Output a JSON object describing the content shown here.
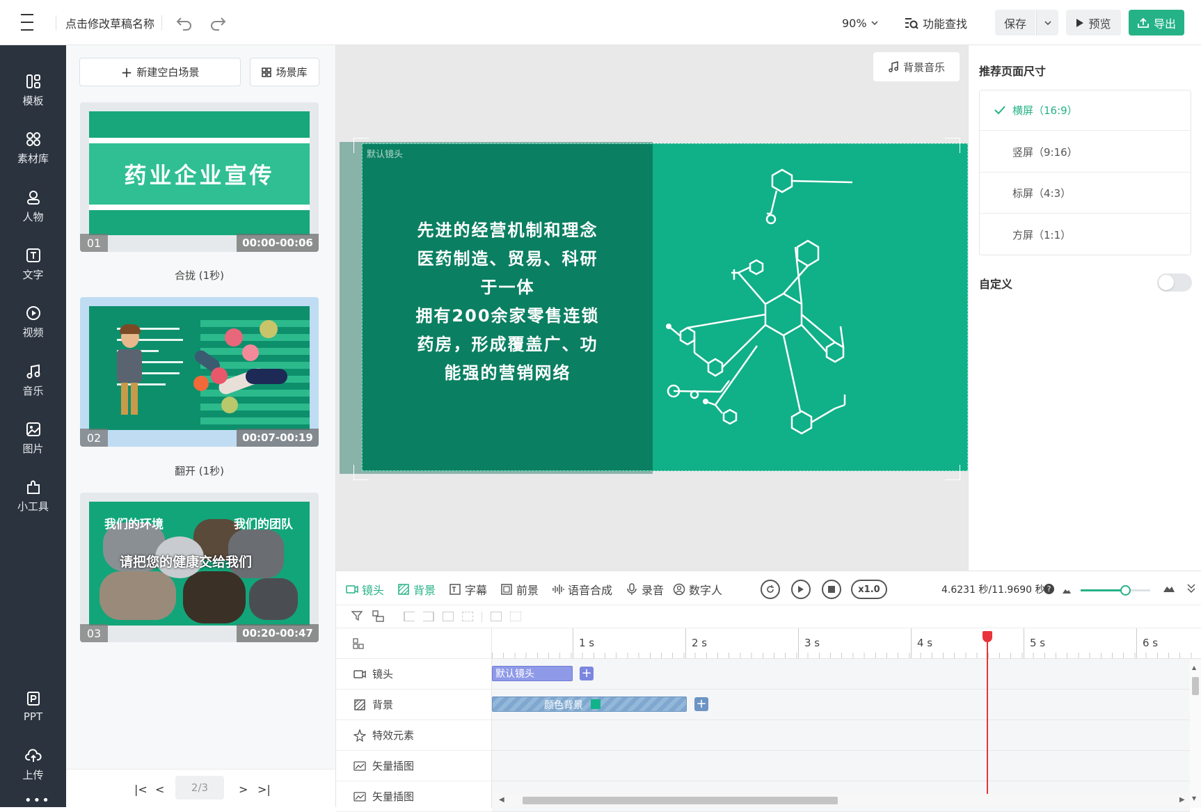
{
  "topbar": {
    "draft_name": "点击修改草稿名称",
    "zoom": "90%",
    "feature_search": "功能查找",
    "save": "保存",
    "preview": "预览",
    "export": "导出"
  },
  "nav": {
    "items": [
      "模板",
      "素材库",
      "人物",
      "文字",
      "视频",
      "音乐",
      "图片",
      "小工具"
    ],
    "bottom": [
      "PPT",
      "上传"
    ]
  },
  "scenes": {
    "new_blank": "新建空白场景",
    "library": "场景库",
    "items": [
      {
        "num": "01",
        "time": "00:00-00:06",
        "caption": "合拢 (1秒)",
        "thumb_title": "药业企业宣传"
      },
      {
        "num": "02",
        "time": "00:07-00:19",
        "caption": "翻开 (1秒)"
      },
      {
        "num": "03",
        "time": "00:20-00:47",
        "caption": "",
        "thumb_left": "我们的环境",
        "thumb_right": "我们的团队",
        "thumb_center": "请把您的健康交给我们"
      }
    ],
    "pager": {
      "page": "2/3"
    }
  },
  "canvas": {
    "bg_music": "背景音乐",
    "default_camera": "默认镜头",
    "lines": [
      "先进的经营机制和理念",
      "医药制造、贸易、科研",
      "于一体",
      "拥有200余家零售连锁",
      "药房，形成覆盖广、功",
      "能强的营销网络"
    ]
  },
  "right": {
    "title": "推荐页面尺寸",
    "sizes": [
      "横屏（16:9）",
      "竖屏（9:16）",
      "标屏（4:3）",
      "方屏（1:1）"
    ],
    "custom": "自定义"
  },
  "timeline": {
    "tabs": [
      "镜头",
      "背景",
      "字幕",
      "前景",
      "语音合成",
      "录音",
      "数字人"
    ],
    "speed": "x1.0",
    "time": "4.6231 秒/11.9690 秒",
    "ticks": [
      "1 s",
      "2 s",
      "3 s",
      "4 s",
      "5 s",
      "6 s"
    ],
    "tracks": [
      "镜头",
      "背景",
      "特效元素",
      "矢量插图",
      "矢量插图"
    ],
    "clip_camera": "默认镜头",
    "clip_bg": "颜色背景"
  },
  "colors": {
    "brand": "#25b286",
    "nav_bg": "#2b333e",
    "scene_green": "#0f9b74",
    "playhead": "#e8333a"
  }
}
